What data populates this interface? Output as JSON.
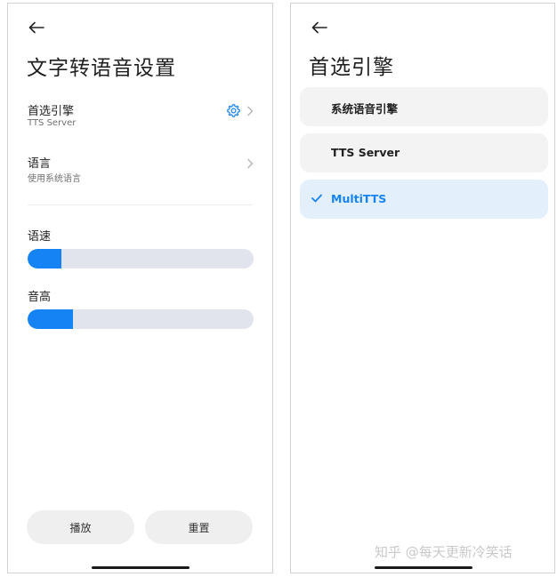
{
  "left": {
    "title": "文字转语音设置",
    "engine_row": {
      "title": "首选引擎",
      "subtitle": "TTS Server"
    },
    "language_row": {
      "title": "语言",
      "subtitle": "使用系统语言"
    },
    "speed": {
      "label": "语速",
      "level_percent": 15
    },
    "pitch": {
      "label": "音高",
      "level_percent": 20
    },
    "buttons": {
      "play": "播放",
      "reset": "重置"
    }
  },
  "right": {
    "title": "首选引擎",
    "engines": [
      {
        "label": "系统语音引擎",
        "selected": false
      },
      {
        "label": "TTS Server",
        "selected": false
      },
      {
        "label": "MultiTTS",
        "selected": true
      }
    ]
  },
  "watermark": "知乎 @每天更新冷笑话",
  "colors": {
    "accent": "#1683f4",
    "track": "#e1e4ec",
    "selected_bg": "#e3f0fc",
    "item_bg": "#f3f3f3"
  },
  "icons": [
    "back-arrow-icon",
    "gear-icon",
    "chevron-right-icon",
    "check-icon"
  ]
}
